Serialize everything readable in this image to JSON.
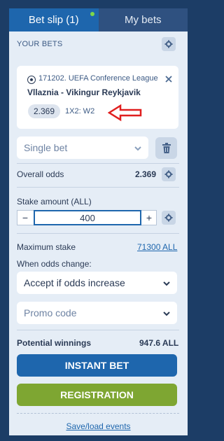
{
  "tabs": {
    "bet_slip": "Bet slip (1)",
    "my_bets": "My bets"
  },
  "your_bets_label": "YOUR BETS",
  "bet": {
    "league": "171202. UEFA Conference League",
    "match": "Vllaznia - Vikingur Reykjavik",
    "odds": "2.369",
    "market": "1X2: W2"
  },
  "bet_type": "Single bet",
  "overall_odds": {
    "label": "Overall odds",
    "value": "2.369"
  },
  "stake": {
    "label": "Stake amount (ALL)",
    "value": "400",
    "minus": "−",
    "plus": "+"
  },
  "maximum_stake": {
    "label": "Maximum stake",
    "value": "71300 ALL"
  },
  "odds_change": {
    "label": "When odds change:",
    "selected": "Accept if odds increase"
  },
  "promo_code": {
    "placeholder": "Promo code"
  },
  "potential_winnings": {
    "label": "Potential winnings",
    "value": "947.6 ALL"
  },
  "buttons": {
    "instant_bet": "INSTANT BET",
    "registration": "REGISTRATION"
  },
  "save_load": "Save/load events",
  "colors": {
    "accent": "#1e66ad",
    "registration": "#7ea632",
    "background": "#1c3d66",
    "panel": "#e5edf6",
    "arrow": "#e01f1f"
  },
  "icons": {
    "settings": "gear-icon",
    "sport": "soccer-ball-icon",
    "remove": "close-icon",
    "delete": "trash-icon",
    "dropdown": "chevron-down-icon",
    "annotation": "red-arrow-icon"
  }
}
